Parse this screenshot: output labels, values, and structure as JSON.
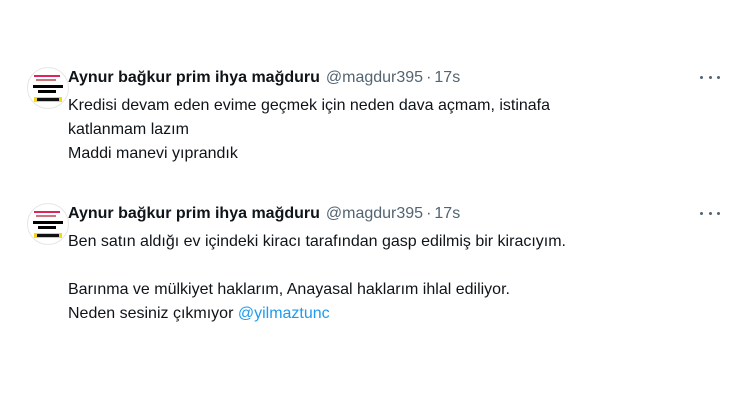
{
  "tweets": [
    {
      "display_name": "Aynur bağkur prim ihya mağduru",
      "handle": "@magdur395",
      "separator": "·",
      "time": "17s",
      "lines": [
        "Kredisi devam eden evime geçmek için neden dava açmam, istinafa",
        "katlanmam lazım",
        "Maddi manevi yıprandık"
      ]
    },
    {
      "display_name": "Aynur bağkur prim ihya mağduru",
      "handle": "@magdur395",
      "separator": "·",
      "time": "17s",
      "lines": [
        "Ben satın aldığı ev içindeki kiracı tarafından gasp edilmiş bir kiracıyım.",
        "",
        "Barınma ve mülkiyet haklarım, Anayasal haklarım ihlal ediliyor."
      ],
      "last_line_text": "Neden sesiniz çıkmıyor ",
      "mention": "@yilmaztunc"
    }
  ],
  "icons": {
    "avatar": "campaign-poster-avatar",
    "more": "more-options-icon"
  },
  "colors": {
    "text": "#0f1419",
    "secondary": "#536471",
    "link": "#1d9bf0",
    "background": "#ffffff"
  }
}
